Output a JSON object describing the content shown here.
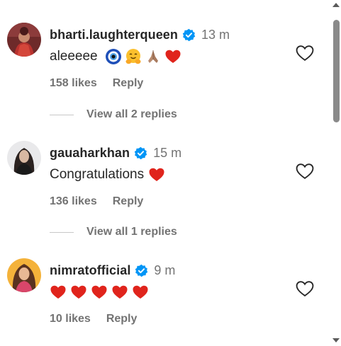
{
  "comments": [
    {
      "username": "bharti.laughterqueen",
      "verified": true,
      "time": "13 m",
      "text": "aleeeee",
      "emojis": [
        "nazar-amulet",
        "hugging-face",
        "folded-hands",
        "red-heart"
      ],
      "likes": "158 likes",
      "reply_label": "Reply",
      "view_replies": "View all 2 replies"
    },
    {
      "username": "gauaharkhan",
      "verified": true,
      "time": "15 m",
      "text": "Congratulations",
      "emojis": [
        "red-heart"
      ],
      "likes": "136 likes",
      "reply_label": "Reply",
      "view_replies": "View all 1 replies"
    },
    {
      "username": "nimratofficial",
      "verified": true,
      "time": "9 m",
      "text": "",
      "emojis": [
        "red-heart",
        "red-heart",
        "red-heart",
        "red-heart",
        "red-heart"
      ],
      "likes": "10 likes",
      "reply_label": "Reply"
    }
  ],
  "colors": {
    "verified_badge": "#0095f6",
    "heart_emoji": "#e0241c",
    "muted_text": "#737373",
    "primary_text": "#262626"
  }
}
